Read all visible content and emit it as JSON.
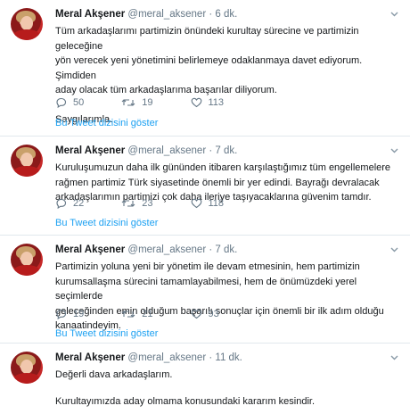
{
  "tweets": [
    {
      "name": "Meral Akşener",
      "handle": "@meral_aksener",
      "time": "6 dk.",
      "text_lines": [
        "Tüm arkadaşlarımı partimizin önündeki kurultay sürecine ve partimizin geleceğine",
        "yön verecek yeni yönetimini belirlemeye odaklanmaya davet ediyorum. Şimdiden",
        "aday olacak tüm arkadaşlarıma başarılar diliyorum."
      ],
      "text_extra": "Saygılarımla.",
      "replies": "50",
      "retweets": "19",
      "likes": "113",
      "thread_label": "Bu Tweet dizisini göster"
    },
    {
      "name": "Meral Akşener",
      "handle": "@meral_aksener",
      "time": "7 dk.",
      "text_lines": [
        "Kuruluşumuzun daha ilk gününden itibaren karşılaştığımız tüm engellemelere",
        "rağmen partimiz Türk siyasetinde önemli bir yer edindi. Bayrağı devralacak",
        "arkadaşlarımın partimizi çok daha ileriye taşıyacaklarına güvenim tamdır."
      ],
      "replies": "22",
      "retweets": "23",
      "likes": "118",
      "thread_label": "Bu Tweet dizisini göster"
    },
    {
      "name": "Meral Akşener",
      "handle": "@meral_aksener",
      "time": "7 dk.",
      "text_lines": [
        "Partimizin yoluna yeni bir yönetim ile devam etmesinin, hem partimizin",
        "kurumsallaşma sürecini tamamlayabilmesi, hem de önümüzdeki yerel seçimlerde",
        "geleceğinden emin olduğum başarılı sonuçlar için önemli bir ilk adım olduğu",
        "kanaatindeyim."
      ],
      "replies": "19",
      "retweets": "21",
      "likes": "93",
      "thread_label": "Bu Tweet dizisini göster"
    },
    {
      "name": "Meral Akşener",
      "handle": "@meral_aksener",
      "time": "11 dk.",
      "text_lines": [
        "Değerli dava arkadaşlarım."
      ],
      "text_extra": "Kurultayımızda aday olmama konusundaki kararım kesindir."
    }
  ],
  "separator": "·"
}
